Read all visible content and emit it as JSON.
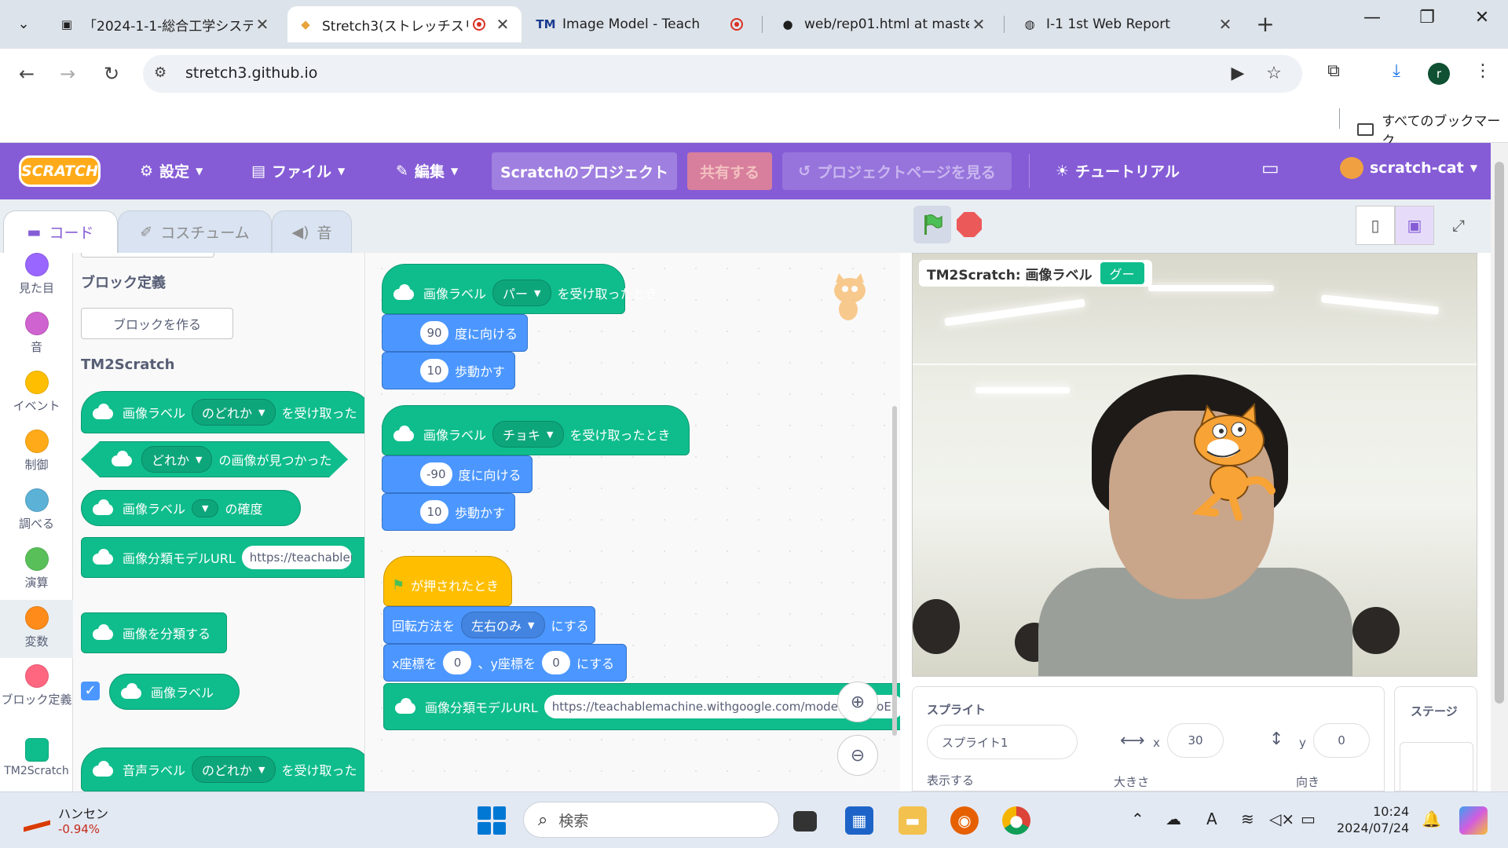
{
  "browser": {
    "tabs": [
      {
        "title": "「2024-1-1-総合工学システ",
        "favicon": "doc-icon"
      },
      {
        "title": "Stretch3(ストレッチスリー",
        "favicon": "cat-icon",
        "recording": true
      },
      {
        "title": "Image Model - Teach",
        "favicon": "tm-icon",
        "recording": true
      },
      {
        "title": "web/rep01.html at maste",
        "favicon": "github-icon"
      },
      {
        "title": "I-1 1st Web Report",
        "favicon": "globe-icon"
      }
    ],
    "url": "stretch3.github.io",
    "bookmarks_all": "すべてのブックマーク",
    "profile_initial": "r"
  },
  "scratch_menu": {
    "logo": "SCRATCH",
    "settings": "設定",
    "file": "ファイル",
    "edit": "編集",
    "project_title": "Scratchのプロジェクト",
    "share": "共有する",
    "see_project_page": "プロジェクトページを見る",
    "tutorials": "チュートリアル",
    "username": "scratch-cat"
  },
  "editor_tabs": {
    "code": "コード",
    "costumes": "コスチューム",
    "sounds": "音"
  },
  "categories": [
    {
      "label": "見た目",
      "color": "#9966ff"
    },
    {
      "label": "音",
      "color": "#cf63cf"
    },
    {
      "label": "イベント",
      "color": "#ffbf00"
    },
    {
      "label": "制御",
      "color": "#ffab19"
    },
    {
      "label": "調べる",
      "color": "#5cb1d6"
    },
    {
      "label": "演算",
      "color": "#59c059"
    },
    {
      "label": "変数",
      "color": "#ff8c1a"
    },
    {
      "label": "ブロック定義",
      "color": "#ff6680"
    },
    {
      "label": "TM2Scratch",
      "color": "#0fbd8c"
    }
  ],
  "flyout": {
    "my_blocks_heading": "ブロック定義",
    "make_block": "ブロックを作る",
    "tm_heading": "TM2Scratch",
    "b1_text": "画像ラベル",
    "b1_dd": "のどれか",
    "b1_tail": "を受け取った",
    "b2_dd": "どれか",
    "b2_tail": "の画像が見つかった",
    "b3_text": "画像ラベル",
    "b3_tail": "の確度",
    "b4_text": "画像分類モデルURL",
    "b4_val": "https://teachablem",
    "b5_text": "画像を分類する",
    "b6_text": "画像ラベル",
    "b7_text": "音声ラベル",
    "b7_dd": "のどれか",
    "b7_tail": "を受け取った"
  },
  "scripts": {
    "s1": {
      "hat_text": "画像ラベル",
      "hat_dd": "パー",
      "hat_tail": "を受け取ったとき",
      "turn_val": "90",
      "turn_text": "度に向ける",
      "move_val": "10",
      "move_text": "歩動かす"
    },
    "s2": {
      "hat_text": "画像ラベル",
      "hat_dd": "チョキ",
      "hat_tail": "を受け取ったとき",
      "turn_val": "-90",
      "turn_text": "度に向ける",
      "move_val": "10",
      "move_text": "歩動かす"
    },
    "s3": {
      "flag_text": "が押されたとき",
      "rot_text": "回転方法を",
      "rot_dd": "左右のみ",
      "rot_tail": "にする",
      "goto_x_label": "x座標を",
      "goto_x": "0",
      "goto_y_label": "、y座標を",
      "goto_y": "0",
      "goto_tail": "にする",
      "url_text": "画像分類モデルURL",
      "url_val": "https://teachablemachine.withgoogle.com/model",
      "url_overflow": "t0oE"
    }
  },
  "stage": {
    "monitor_label": "TM2Scratch: 画像ラベル",
    "monitor_value": "グー"
  },
  "sprite_info": {
    "sprite_label": "スプライト",
    "sprite_name": "スプライト1",
    "x_label": "x",
    "x": "30",
    "y_label": "y",
    "y": "0",
    "show_label": "表示する",
    "size_label": "大きさ",
    "direction_label": "向き",
    "stage_label": "ステージ"
  },
  "taskbar": {
    "stock_name": "ハンセン",
    "stock_change": "-0.94%",
    "search_placeholder": "検索",
    "ime": "A",
    "time": "10:24",
    "date": "2024/07/24"
  }
}
